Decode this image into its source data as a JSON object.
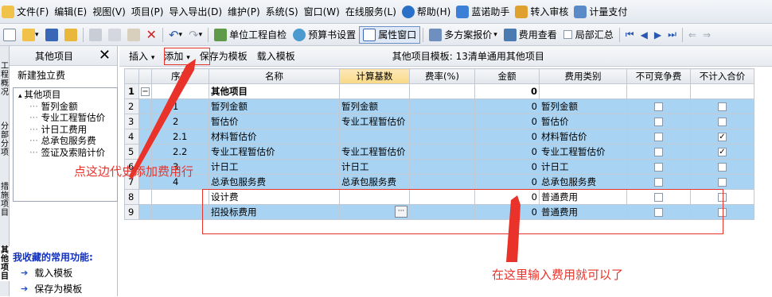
{
  "menu": {
    "items": [
      {
        "label": "文件(F)",
        "icon": "file-icon"
      },
      {
        "label": "编辑(E)"
      },
      {
        "label": "视图(V)"
      },
      {
        "label": "项目(P)"
      },
      {
        "label": "导入导出(D)"
      },
      {
        "label": "维护(P)"
      },
      {
        "label": "系统(S)"
      },
      {
        "label": "窗口(W)"
      },
      {
        "label": "在线服务(L)"
      },
      {
        "label": "帮助(H)",
        "icon": "help-icon"
      },
      {
        "label": "蓝诺助手",
        "icon": "assistant-icon"
      },
      {
        "label": "转入审核",
        "icon": "audit-icon"
      },
      {
        "label": "计量支付",
        "icon": "payment-icon"
      }
    ]
  },
  "toolbar": {
    "self_check": "单位工程自检",
    "budget_settings": "预算书设置",
    "property_window": "属性窗口",
    "multi_plan_quote": "多方案报价",
    "fee_view": "费用查看",
    "partial_summary": "局部汇总"
  },
  "left_strip": {
    "tabs": [
      "工程概况",
      "分部分项",
      "措施项目",
      "其他项目"
    ]
  },
  "left_panel": {
    "title": "其他项目",
    "close": "✕",
    "new_item": "新建独立费",
    "tree": [
      {
        "label": "其他项目",
        "level": 0
      },
      {
        "label": "暂列金额",
        "level": 1
      },
      {
        "label": "专业工程暂估价",
        "level": 1
      },
      {
        "label": "计日工费用",
        "level": 1
      },
      {
        "label": "总承包服务费",
        "level": 1
      },
      {
        "label": "签证及索赔计价",
        "level": 1
      }
    ],
    "favorites_title": "我收藏的常用功能:",
    "favorites": [
      "载入模板",
      "保存为模板"
    ]
  },
  "subbar": {
    "insert": "插入",
    "add": "添加",
    "save_template": "保存为模板",
    "load_template": "载入模板",
    "template_info": "其他项目模板: 13清单通用其他项目"
  },
  "table": {
    "headers": [
      "序号",
      "名称",
      "计算基数",
      "费率(%)",
      "金额",
      "费用类别",
      "不可竞争费",
      "不计入合价"
    ],
    "rows": [
      {
        "row": "1",
        "expand": "−",
        "seq": "",
        "name": "其他项目",
        "base": "",
        "rate": "",
        "amount": "0",
        "category": "",
        "noncomp": false,
        "exclude": false,
        "style": "white",
        "bold": true
      },
      {
        "row": "2",
        "expand": "",
        "seq": "1",
        "name": "暂列金额",
        "base": "暂列金额",
        "rate": "",
        "amount": "0",
        "category": "暂列金额",
        "noncomp": false,
        "exclude": false,
        "style": "blue"
      },
      {
        "row": "3",
        "expand": "",
        "seq": "2",
        "name": "暂估价",
        "base": "专业工程暂估价",
        "rate": "",
        "amount": "0",
        "category": "暂估价",
        "noncomp": false,
        "exclude": false,
        "style": "blue"
      },
      {
        "row": "4",
        "expand": "",
        "seq": "2.1",
        "name": "材料暂估价",
        "base": "",
        "rate": "",
        "amount": "0",
        "category": "材料暂估价",
        "noncomp": false,
        "exclude": true,
        "style": "blue"
      },
      {
        "row": "5",
        "expand": "",
        "seq": "2.2",
        "name": "专业工程暂估价",
        "base": "专业工程暂估价",
        "rate": "",
        "amount": "0",
        "category": "专业工程暂估价",
        "noncomp": false,
        "exclude": true,
        "style": "blue"
      },
      {
        "row": "6",
        "expand": "",
        "seq": "3",
        "name": "计日工",
        "base": "计日工",
        "rate": "",
        "amount": "0",
        "category": "计日工",
        "noncomp": false,
        "exclude": false,
        "style": "blue"
      },
      {
        "row": "7",
        "expand": "",
        "seq": "4",
        "name": "总承包服务费",
        "base": "总承包服务费",
        "rate": "",
        "amount": "0",
        "category": "总承包服务费",
        "noncomp": false,
        "exclude": false,
        "style": "blue"
      },
      {
        "row": "8",
        "expand": "",
        "seq": "",
        "name": "设计费",
        "base": "",
        "rate": "",
        "amount": "0",
        "category": "普通费用",
        "noncomp": false,
        "exclude": false,
        "style": "white"
      },
      {
        "row": "9",
        "expand": "",
        "seq": "",
        "name": "招投标费用",
        "base": "",
        "rate": "",
        "amount": "0",
        "category": "普通费用",
        "noncomp": false,
        "exclude": false,
        "style": "blue",
        "editing": true
      }
    ]
  },
  "annotations": {
    "note_add_row": "点这边代史添加费用行",
    "note_enter_fee": "在这里输入费用就可以了"
  },
  "colors": {
    "row_highlight": "#a9d3f2",
    "annotation_red": "#e8322a",
    "favorites_title": "#1030c0"
  }
}
